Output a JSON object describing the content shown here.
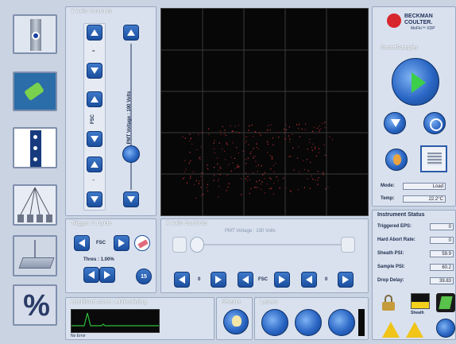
{
  "y_axis": {
    "title": "Y Axis Controls",
    "param_label": "FSC",
    "pmt_label": "PMT Voltage : 190 Volts",
    "mark_top": "=",
    "mark_bottom": "–"
  },
  "trigger": {
    "title": "Trigger & Cycle",
    "param": "FSC",
    "thres_label": "Thres : 1.00%",
    "count": "15"
  },
  "x_axis": {
    "title": "X Axis Controls",
    "slider_hint": "PMT Voltage : 190 Volts",
    "param1": "0",
    "param2": "FSC",
    "param3": "0"
  },
  "intellisort": {
    "title": "IntelliSort state : Maintaining",
    "caption": "No Error"
  },
  "bottom": {
    "stream_label": "Stream",
    "lasers_label": "Lasers"
  },
  "brand": {
    "line1": "BECKMAN",
    "line2": "COULTER.",
    "line3": "MoFlo™ XDP"
  },
  "smartsampler": {
    "title": "SmartSampler",
    "mode_label": "Mode:",
    "mode_value": "Load",
    "temp_label": "Temp:",
    "temp_value": "22.2°C"
  },
  "status": {
    "title": "Instrument Status",
    "rows": [
      {
        "label": "Triggered EPS:",
        "value": "0"
      },
      {
        "label": "Hard Abort Rate:",
        "value": "0"
      },
      {
        "label": "Sheath PSI:",
        "value": "59.9"
      },
      {
        "label": "Sample PSI:",
        "value": "60.2"
      },
      {
        "label": "Drop Delay:",
        "value": "39.83"
      }
    ],
    "sheath_label": "Sheath"
  },
  "sidebar": {
    "percent_icon": "%"
  },
  "colors": {
    "accent": "#1b4e9e",
    "panel": "#d9e1ee",
    "plot_bg": "#070707",
    "trace": "#2fbf3a"
  }
}
